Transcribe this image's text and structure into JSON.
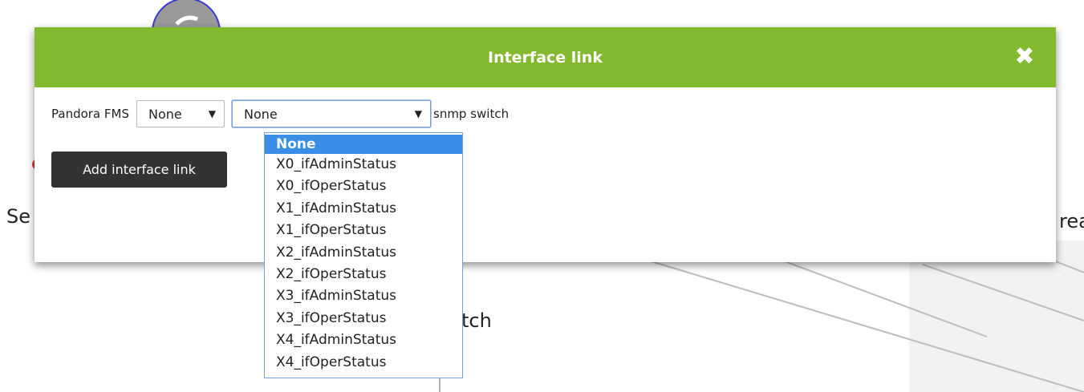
{
  "background": {
    "left_label": "Se",
    "right_label": "rea",
    "switch_label": "tch"
  },
  "dialog": {
    "title": "Interface link",
    "close_icon": "close-icon",
    "agent1_label": "Pandora FMS",
    "agent1_select_value": "None",
    "module_select_value": "None",
    "agent2_label": "snmp switch",
    "add_button_label": "Add interface link",
    "header_color": "#82b92e"
  },
  "dropdown": {
    "options": [
      "None",
      "X0_ifAdminStatus",
      "X0_ifOperStatus",
      "X1_ifAdminStatus",
      "X1_ifOperStatus",
      "X2_ifAdminStatus",
      "X2_ifOperStatus",
      "X3_ifAdminStatus",
      "X3_ifOperStatus",
      "X4_ifAdminStatus",
      "X4_ifOperStatus"
    ],
    "selected_index": 0,
    "selected_color": "#3b8ee8"
  }
}
